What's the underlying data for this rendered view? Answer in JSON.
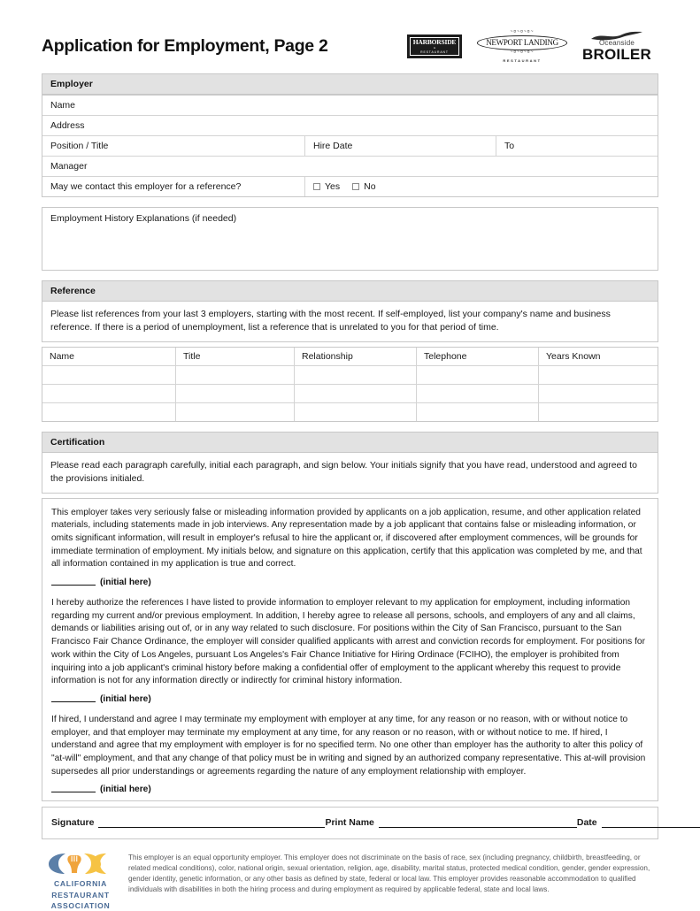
{
  "header": {
    "title": "Application for Employment, Page 2",
    "logos": [
      {
        "name": "harborside-restaurant-logo",
        "main": "HARBORSIDE",
        "amp": "&",
        "sub": "RESTAURANT"
      },
      {
        "name": "newport-landing-restaurant-logo",
        "ornament_top": "~¤~¤~¤~",
        "main": "NEWPORT LANDING",
        "ornament_bottom": "~¤~¤~¤~",
        "sub": "RESTAURANT"
      },
      {
        "name": "oceanside-broiler-logo",
        "top": "Oceanside",
        "main": "BROILER"
      }
    ]
  },
  "employer": {
    "section_title": "Employer",
    "name_label": "Name",
    "address_label": "Address",
    "position_label": "Position / Title",
    "hire_date_label": "Hire Date",
    "to_label": "To",
    "manager_label": "Manager",
    "contact_question": "May we contact this employer for a reference?",
    "yes_label": "Yes",
    "no_label": "No",
    "values": {
      "name": "",
      "address": "",
      "position": "",
      "hire_date": "",
      "to": "",
      "manager": ""
    }
  },
  "explanations": {
    "label": "Employment History Explanations (if needed)",
    "value": ""
  },
  "reference": {
    "section_title": "Reference",
    "intro": "Please list references from your last 3 employers, starting with the most recent. If self-employed, list your company's name and business reference. If there is a period of unemployment, list a reference that is unrelated to you for that period of time.",
    "columns": [
      "Name",
      "Title",
      "Relationship",
      "Telephone",
      "Years Known"
    ],
    "rows": [
      [
        "",
        "",
        "",
        "",
        ""
      ],
      [
        "",
        "",
        "",
        "",
        ""
      ],
      [
        "",
        "",
        "",
        "",
        ""
      ]
    ]
  },
  "certification": {
    "section_title": "Certification",
    "intro": "Please read each paragraph carefully, initial each paragraph, and sign below. Your initials signify that you have read, understood and agreed to the provisions initialed.",
    "paragraphs": [
      "This employer takes very seriously false or misleading information provided by applicants on a job application, resume, and other application related materials, including statements made in job interviews. Any representation made by a job applicant that contains false or misleading information, or omits significant information, will result in employer's refusal to hire the applicant or, if discovered after employment commences, will be grounds for immediate termination of employment. My initials below, and signature on this application, certify that this application was completed by me, and that all information contained in my application is true and correct.",
      "I hereby authorize the references I have listed to provide information to employer relevant to my application for employment, including information regarding my current and/or previous employment. In addition, I hereby agree to release all persons, schools, and employers of any and all claims, demands or liabilities arising out of, or in any way related to such disclosure. For positions within the City of San Francisco, pursuant to the San Francisco Fair Chance Ordinance, the employer will consider qualified applicants with arrest and conviction records for employment. For positions for work within the City of Los Angeles, pursuant Los Angeles's Fair Chance Initiative for Hiring Ordinace (FCIHO), the employer is prohibited from inquiring into a job applicant's criminal history before making a confidential offer of employment to the applicant whereby this request to provide information is not for any information directly or indirectly for criminal history information.",
      "If hired, I understand and agree I may terminate my employment with employer at any time, for any reason or no reason, with or without notice to employer, and that employer may terminate my employment at any time, for any reason or no reason, with or without notice to me. If hired, I understand and agree that my employment with employer is for no specified term. No one other than employer has the authority to alter this policy of \"at-will\" employment, and that any change of that policy must be in writing and signed by an authorized company representative. This at-will provision supersedes all prior understandings or agreements regarding the nature of any employment relationship with employer."
    ],
    "initial_label": "(initial here)"
  },
  "signature": {
    "signature_label": "Signature",
    "print_name_label": "Print Name",
    "date_label": "Date",
    "signature_value": "",
    "print_name_value": "",
    "date_value": ""
  },
  "footer": {
    "cra_logo_lines": [
      "CALIFORNIA",
      "RESTAURANT",
      "ASSOCIATION"
    ],
    "eeo_text": "This employer is an equal opportunity employer. This employer does not discriminate on the basis of race, sex (including pregnancy, childbirth, breastfeeding, or related medical conditions), color, national origin, sexual orientation, religion, age, disability, marital status, protected medical condition, gender, gender expression, gender identity, genetic information, or any other basis as defined by state, federal or local law. This employer provides reasonable accommodation to qualified individuals with disabilities in both the hiring process and during employment as required by applicable federal, state and local laws."
  },
  "colors": {
    "section_header_bg": "#e2e2e2",
    "border": "#c8c8c8",
    "cra_blue": "#4a6b96",
    "cra_orange": "#f0a43c",
    "cra_yellow": "#f6c344",
    "eeo_text": "#58585a"
  }
}
